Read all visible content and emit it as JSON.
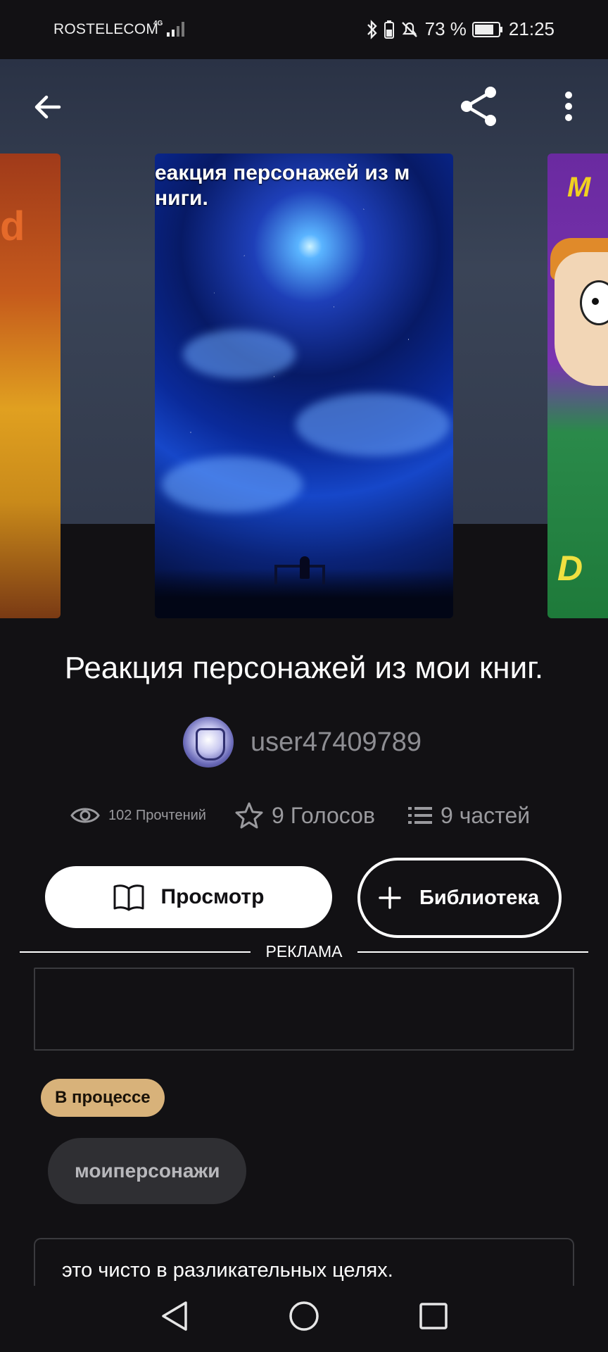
{
  "status_bar": {
    "carrier": "ROSTELECOM",
    "network": "4G",
    "battery_percent": "73 %",
    "time": "21:25"
  },
  "top_bar": {
    "back_icon": "arrow-left-icon",
    "share_icon": "share-icon",
    "more_icon": "more-vertical-icon"
  },
  "covers": {
    "main_cover_text": "еакция персонажей из м\nниги."
  },
  "story": {
    "title": "Реакция персонажей из мои книг.",
    "author": "user47409789",
    "stats": {
      "reads": "102 Прочтений",
      "votes": "9 Голосов",
      "parts": "9 частей"
    }
  },
  "actions": {
    "view_label": "Просмотр",
    "library_label": "Библиотека"
  },
  "ad": {
    "label": "РЕКЛАМА"
  },
  "status_badge": "В процессе",
  "tags": [
    "моиперсонажи"
  ],
  "description": "это чисто в разликательных целях.",
  "colors": {
    "background": "#121114",
    "badge": "#d8b27a",
    "tag_bg": "#2f2f33",
    "text_muted": "#9a9a9e"
  }
}
